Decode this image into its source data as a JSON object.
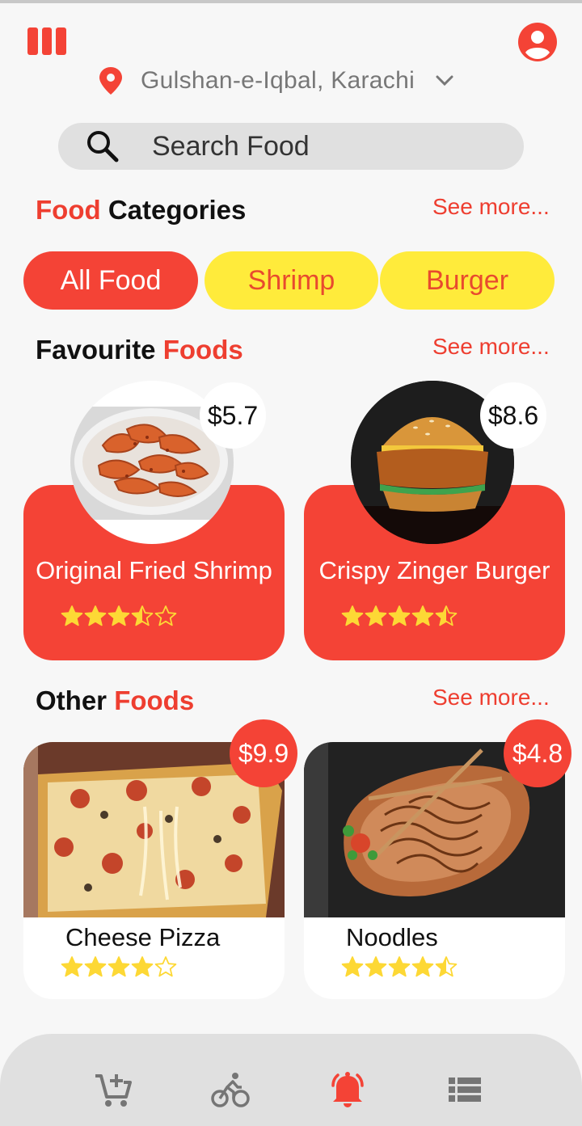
{
  "header": {
    "location": "Gulshan-e-Iqbal, Karachi",
    "icons": {
      "menu": "menu-icon",
      "account": "account-circle-icon",
      "location": "location-pin-icon",
      "dropdown": "chevron-down-icon"
    }
  },
  "search": {
    "placeholder": "Search Food",
    "icon": "search-icon"
  },
  "categories": {
    "title_red": "Food",
    "title_black": "Categories",
    "see_more": "See more...",
    "items": [
      {
        "label": "All Food",
        "active": true
      },
      {
        "label": "Shrimp",
        "active": false
      },
      {
        "label": "Burger",
        "active": false
      }
    ]
  },
  "favourites": {
    "title_black": "Favourite",
    "title_red": "Foods",
    "see_more": "See more...",
    "items": [
      {
        "name": "Original Fried Shrimp",
        "price": "$5.7",
        "rating": 3.5
      },
      {
        "name": "Crispy Zinger Burger",
        "price": "$8.6",
        "rating": 4.5
      }
    ]
  },
  "others": {
    "title_black": "Other",
    "title_red": "Foods",
    "see_more": "See more...",
    "items": [
      {
        "name": "Cheese Pizza",
        "price": "$9.9",
        "rating": 4
      },
      {
        "name": "Noodles",
        "price": "$4.8",
        "rating": 4.5
      }
    ]
  },
  "bottom_nav": {
    "items": [
      {
        "icon": "add-to-cart-icon",
        "active": false
      },
      {
        "icon": "bicycle-icon",
        "active": false
      },
      {
        "icon": "notification-bell-icon",
        "active": true
      },
      {
        "icon": "list-icon",
        "active": false
      }
    ]
  },
  "colors": {
    "primary": "#f44336",
    "accent_yellow": "#ffeb3b",
    "star": "#fdd835",
    "background": "#f7f7f7",
    "nav_bg": "#e0e0e0"
  }
}
